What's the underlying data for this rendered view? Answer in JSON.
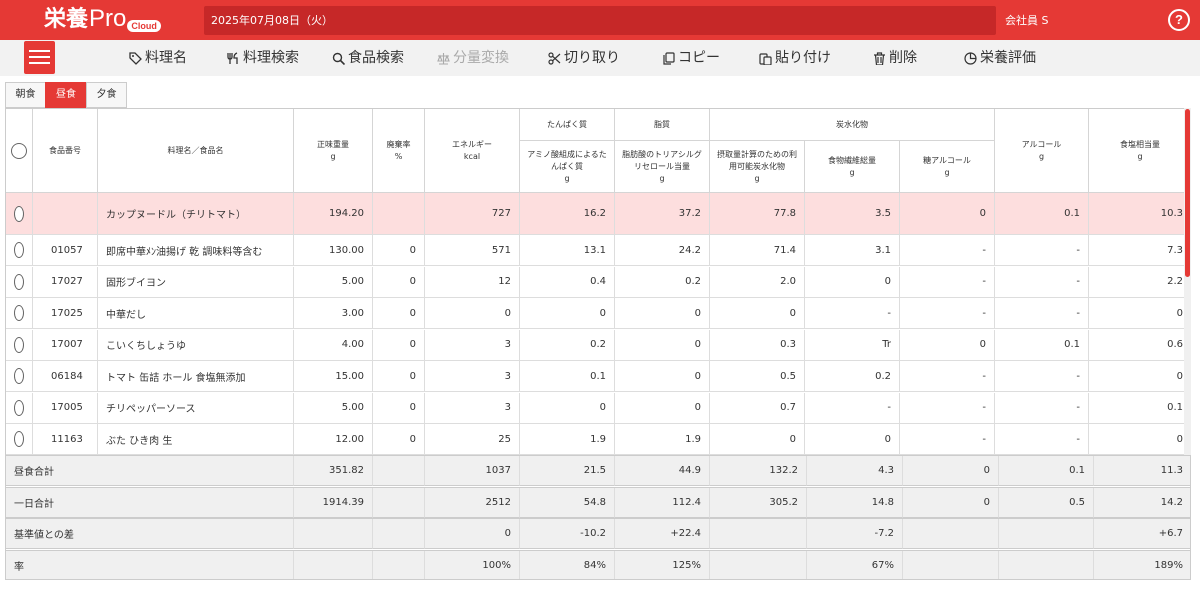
{
  "app": {
    "logo_kanji": "栄養",
    "logo_pro": "Pro",
    "logo_cloud": "Cloud",
    "date": "2025年07月08日（火）",
    "user": "会社員 S",
    "help": "?"
  },
  "toolbar": [
    {
      "label": "料理名",
      "icon": "tag-icon",
      "disabled": false
    },
    {
      "label": "料理検索",
      "icon": "utensils-icon",
      "disabled": false
    },
    {
      "label": "食品検索",
      "icon": "search-icon",
      "disabled": false
    },
    {
      "label": "分量変換",
      "icon": "scale-icon",
      "disabled": true
    },
    {
      "label": "切り取り",
      "icon": "scissors-icon",
      "disabled": false
    },
    {
      "label": "コピー",
      "icon": "copy-icon",
      "disabled": false
    },
    {
      "label": "貼り付け",
      "icon": "paste-icon",
      "disabled": false
    },
    {
      "label": "削除",
      "icon": "trash-icon",
      "disabled": false
    },
    {
      "label": "栄養評価",
      "icon": "pie-chart-icon",
      "disabled": false
    }
  ],
  "tabs": [
    {
      "label": "朝食",
      "active": false
    },
    {
      "label": "昼食",
      "active": true
    },
    {
      "label": "夕食",
      "active": false
    }
  ],
  "headers": {
    "food_no": "食品番号",
    "name": "料理名／食品名",
    "weight": "正味重量",
    "weight_unit": "g",
    "waste": "廃棄率",
    "waste_unit": "%",
    "energy": "エネルギー",
    "energy_unit": "kcal",
    "protein_group": "たんぱく質",
    "protein": "アミノ酸組成によるたんぱく質",
    "protein_unit": "g",
    "fat_group": "脂質",
    "fat": "脂肪酸のトリアシルグリセロール当量",
    "fat_unit": "g",
    "carb_group": "炭水化物",
    "carb": "摂取量計算のための利用可能炭水化物",
    "carb_unit": "g",
    "fiber": "食物繊維総量",
    "fiber_unit": "g",
    "sugaralc": "糖アルコール",
    "sugaralc_unit": "g",
    "alcohol": "アルコール",
    "alcohol_unit": "g",
    "salt": "食塩相当量",
    "salt_unit": "g"
  },
  "dish": {
    "no": "",
    "name": "カップヌードル（チリトマト）",
    "weight": "194.20",
    "waste": "",
    "energy": "727",
    "protein": "16.2",
    "fat": "37.2",
    "carb": "77.8",
    "fiber": "3.5",
    "sugaralc": "0",
    "alcohol": "0.1",
    "salt": "10.3"
  },
  "rows": [
    {
      "no": "01057",
      "name": "即席中華ﾒﾝ油揚げ 乾 調味料等含む",
      "weight": "130.00",
      "waste": "0",
      "energy": "571",
      "protein": "13.1",
      "fat": "24.2",
      "carb": "71.4",
      "fiber": "3.1",
      "sugaralc": "-",
      "alcohol": "-",
      "salt": "7.3"
    },
    {
      "no": "17027",
      "name": "固形ブイヨン",
      "weight": "5.00",
      "waste": "0",
      "energy": "12",
      "protein": "0.4",
      "fat": "0.2",
      "carb": "2.0",
      "fiber": "0",
      "sugaralc": "-",
      "alcohol": "-",
      "salt": "2.2"
    },
    {
      "no": "17025",
      "name": "中華だし",
      "weight": "3.00",
      "waste": "0",
      "energy": "0",
      "protein": "0",
      "fat": "0",
      "carb": "0",
      "fiber": "-",
      "sugaralc": "-",
      "alcohol": "-",
      "salt": "0"
    },
    {
      "no": "17007",
      "name": "こいくちしょうゆ",
      "weight": "4.00",
      "waste": "0",
      "energy": "3",
      "protein": "0.2",
      "fat": "0",
      "carb": "0.3",
      "fiber": "Tr",
      "sugaralc": "0",
      "alcohol": "0.1",
      "salt": "0.6"
    },
    {
      "no": "06184",
      "name": "トマト 缶詰 ホール 食塩無添加",
      "weight": "15.00",
      "waste": "0",
      "energy": "3",
      "protein": "0.1",
      "fat": "0",
      "carb": "0.5",
      "fiber": "0.2",
      "sugaralc": "-",
      "alcohol": "-",
      "salt": "0"
    },
    {
      "no": "17005",
      "name": "チリペッパーソース",
      "weight": "5.00",
      "waste": "0",
      "energy": "3",
      "protein": "0",
      "fat": "0",
      "carb": "0.7",
      "fiber": "-",
      "sugaralc": "-",
      "alcohol": "-",
      "salt": "0.1"
    },
    {
      "no": "11163",
      "name": "ぶた ひき肉 生",
      "weight": "12.00",
      "waste": "0",
      "energy": "25",
      "protein": "1.9",
      "fat": "1.9",
      "carb": "0",
      "fiber": "0",
      "sugaralc": "-",
      "alcohol": "-",
      "salt": "0"
    }
  ],
  "summary": [
    {
      "label": "昼食合計",
      "weight": "351.82",
      "waste": "",
      "energy": "1037",
      "protein": "21.5",
      "fat": "44.9",
      "carb": "132.2",
      "fiber": "4.3",
      "sugaralc": "0",
      "alcohol": "0.1",
      "salt": "11.3"
    },
    {
      "label": "一日合計",
      "weight": "1914.39",
      "waste": "",
      "energy": "2512",
      "protein": "54.8",
      "fat": "112.4",
      "carb": "305.2",
      "fiber": "14.8",
      "sugaralc": "0",
      "alcohol": "0.5",
      "salt": "14.2"
    },
    {
      "label": "基準値との差",
      "weight": "",
      "waste": "",
      "energy": "0",
      "protein": "-10.2",
      "fat": "+22.4",
      "carb": "",
      "fiber": "-7.2",
      "sugaralc": "",
      "alcohol": "",
      "salt": "+6.7"
    },
    {
      "label": "率",
      "weight": "",
      "waste": "",
      "energy": "100%",
      "protein": "84%",
      "fat": "125%",
      "carb": "",
      "fiber": "67%",
      "sugaralc": "",
      "alcohol": "",
      "salt": "189%"
    }
  ]
}
